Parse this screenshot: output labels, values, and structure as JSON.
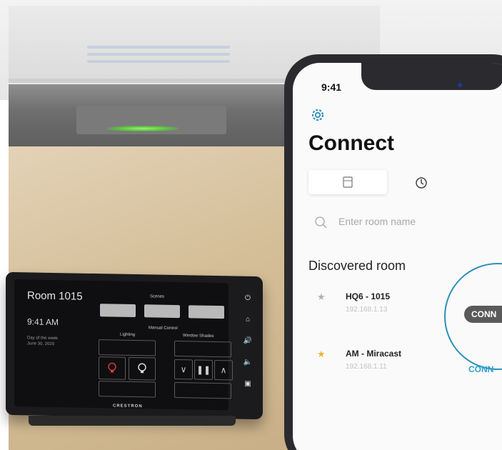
{
  "touch_panel": {
    "room_title": "Room 1015",
    "time": "9:41 AM",
    "day_label": "Day of the week",
    "date": "June 30, 2020",
    "scenes_label": "Scenes",
    "manual_control_label": "Manual Control",
    "lighting_label": "Lighting",
    "window_shades_label": "Window Shades",
    "brand": "CRESTRON"
  },
  "phone": {
    "status_time": "9:41",
    "title": "Connect",
    "search_placeholder": "Enter room name",
    "section_title": "Discovered room",
    "rooms": [
      {
        "name": "HQ6 - 1015",
        "ip": "192.168.1.13",
        "favorite": false
      },
      {
        "name": "AM - Miracast",
        "ip": "192.168.1.11",
        "favorite": true
      }
    ],
    "connect_pill": "CONN",
    "connect_link": "CONN",
    "accent_color": "#2e8fb8",
    "favorite_color": "#f2b233",
    "icons": [
      "gear-icon",
      "room-list-icon",
      "history-icon",
      "search-icon",
      "star-icon"
    ]
  }
}
